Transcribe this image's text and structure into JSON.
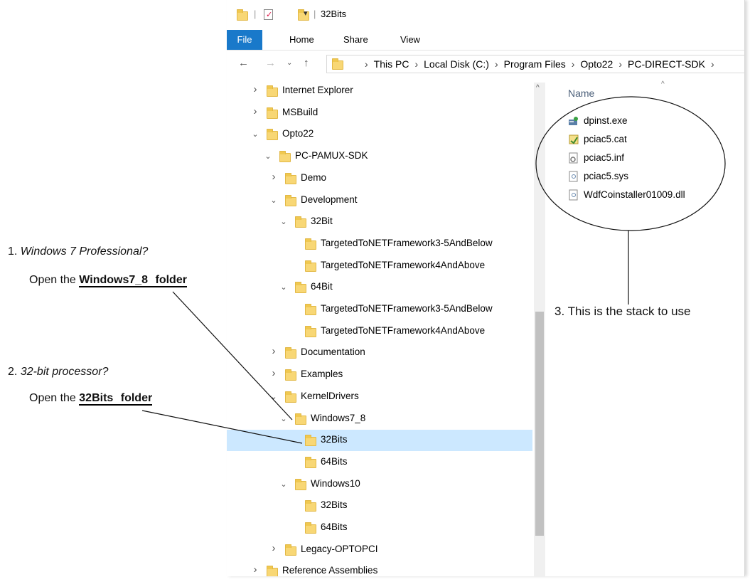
{
  "window": {
    "title": "32Bits"
  },
  "ribbon": {
    "tabs": [
      "File",
      "Home",
      "Share",
      "View"
    ]
  },
  "address": {
    "crumbs": [
      "This PC",
      "Local Disk (C:)",
      "Program Files",
      "Opto22",
      "PC-DIRECT-SDK"
    ]
  },
  "tree": [
    {
      "label": "Internet Explorer",
      "level": 0,
      "state": "collapsed"
    },
    {
      "label": "MSBuild",
      "level": 0,
      "state": "collapsed"
    },
    {
      "label": "Opto22",
      "level": 0,
      "state": "expanded"
    },
    {
      "label": "PC-PAMUX-SDK",
      "level": 1,
      "state": "expanded"
    },
    {
      "label": "Demo",
      "level": 2,
      "state": "collapsed"
    },
    {
      "label": "Development",
      "level": 2,
      "state": "expanded"
    },
    {
      "label": "32Bit",
      "level": 3,
      "state": "expanded"
    },
    {
      "label": "TargetedToNETFramework3-5AndBelow",
      "level": 4,
      "state": "none"
    },
    {
      "label": "TargetedToNETFramework4AndAbove",
      "level": 4,
      "state": "none"
    },
    {
      "label": "64Bit",
      "level": 3,
      "state": "expanded"
    },
    {
      "label": "TargetedToNETFramework3-5AndBelow",
      "level": 4,
      "state": "none"
    },
    {
      "label": "TargetedToNETFramework4AndAbove",
      "level": 4,
      "state": "none"
    },
    {
      "label": "Documentation",
      "level": 2,
      "state": "collapsed"
    },
    {
      "label": "Examples",
      "level": 2,
      "state": "collapsed"
    },
    {
      "label": "KernelDrivers",
      "level": 2,
      "state": "expanded"
    },
    {
      "label": "Windows7_8",
      "level": 3,
      "state": "expanded"
    },
    {
      "label": "32Bits",
      "level": 4,
      "state": "none",
      "selected": true
    },
    {
      "label": "64Bits",
      "level": 4,
      "state": "none"
    },
    {
      "label": "Windows10",
      "level": 3,
      "state": "expanded"
    },
    {
      "label": "32Bits",
      "level": 4,
      "state": "none"
    },
    {
      "label": "64Bits",
      "level": 4,
      "state": "none"
    },
    {
      "label": "Legacy-OPTOPCI",
      "level": 2,
      "state": "collapsed"
    },
    {
      "label": "Reference Assemblies",
      "level": 0,
      "state": "collapsed"
    }
  ],
  "files": {
    "header": "Name",
    "items": [
      {
        "name": "dpinst.exe",
        "icon": "installer-icon"
      },
      {
        "name": "pciac5.cat",
        "icon": "catalog-icon"
      },
      {
        "name": "pciac5.inf",
        "icon": "settings-file-icon"
      },
      {
        "name": "pciac5.sys",
        "icon": "system-file-icon"
      },
      {
        "name": "WdfCoinstaller01009.dll",
        "icon": "dll-file-icon"
      }
    ]
  },
  "annotations": {
    "a1_num": "1.",
    "a1_q": "Windows 7 Professional?",
    "a1_pre": "Open the ",
    "a1_bold": "Windows7_8 folder",
    "a2_num": "2.",
    "a2_q": "32-bit processor?",
    "a2_pre": "Open the ",
    "a2_bold": "32Bits folder",
    "a3": "3. This is the stack to use"
  },
  "colors": {
    "selection": "#cce8ff",
    "file_tab": "#1979ca",
    "folder": "#f8d775"
  }
}
